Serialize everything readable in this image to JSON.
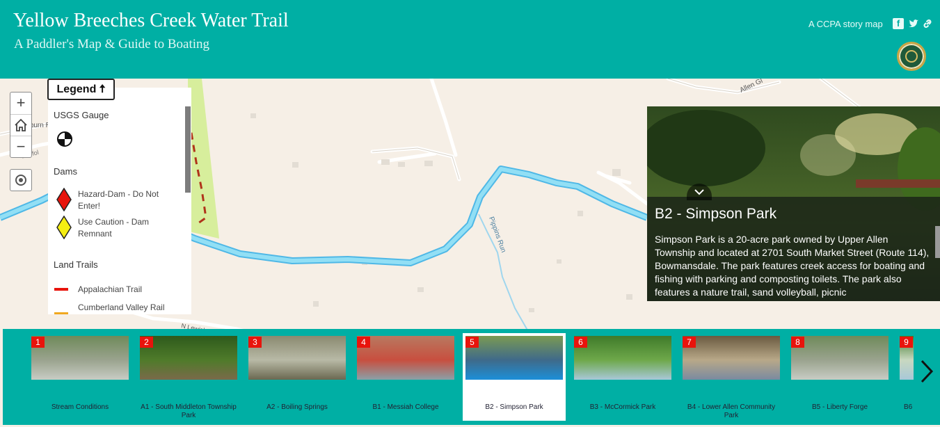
{
  "header": {
    "title": "Yellow Breeches Creek Water Trail",
    "subtitle": "A Paddler's Map & Guide to Boating",
    "storymap_link": "A CCPA story map",
    "social_icons": [
      "facebook-icon",
      "twitter-icon",
      "link-icon"
    ]
  },
  "map": {
    "zoom_in": "+",
    "home_icon": "home-icon",
    "zoom_out": "−",
    "locate_icon": "locate-icon",
    "labels": {
      "road1": "Lisburn Rd",
      "road2": "Allen Gl",
      "road3": "Morfol",
      "road4": "N Lewisberry",
      "stream": "Pippins Run"
    }
  },
  "legend": {
    "toggle_label": "Legend 🠅",
    "sections": [
      {
        "heading": "USGS Gauge",
        "items": []
      },
      {
        "heading": "Dams",
        "items": [
          "Hazard-Dam - Do Not Enter!",
          "Use Caution - Dam Remnant"
        ]
      },
      {
        "heading": "Land Trails",
        "items": [
          "Appalachian Trail",
          "Cumberland Valley Rail"
        ]
      }
    ]
  },
  "story": {
    "title": "B2 - Simpson Park",
    "body": "Simpson Park is a 20-acre park owned by Upper Allen Township and located at 2701 South Market Street (Route 114), Bowmansdale. The park features creek access for boating and fishing with parking and composting toilets. The park also features a nature trail, sand volleyball, picnic"
  },
  "carousel": {
    "active_index": 4,
    "items": [
      {
        "num": "1",
        "caption": "Stream Conditions"
      },
      {
        "num": "2",
        "caption": "A1 - South Middleton Township Park"
      },
      {
        "num": "3",
        "caption": "A2 - Boiling Springs"
      },
      {
        "num": "4",
        "caption": "B1 - Messiah College"
      },
      {
        "num": "5",
        "caption": "B2 - Simpson Park"
      },
      {
        "num": "6",
        "caption": "B3 - McCormick Park"
      },
      {
        "num": "7",
        "caption": "B4 - Lower Allen Community Park"
      },
      {
        "num": "8",
        "caption": "B5 - Liberty Forge"
      },
      {
        "num": "9",
        "caption": "B6"
      }
    ],
    "next_icon": "chevron-right-icon"
  },
  "colors": {
    "header_bg": "#00afa4",
    "river": "#7fd3ee",
    "map_bg": "#f6efe6",
    "badge": "#e8140c"
  }
}
